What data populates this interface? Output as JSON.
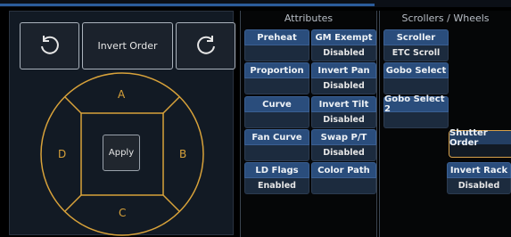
{
  "left": {
    "invert_order_label": "Invert Order",
    "apply_label": "Apply",
    "labels": {
      "a": "A",
      "b": "B",
      "c": "C",
      "d": "D"
    }
  },
  "attributes": {
    "title": "Attributes",
    "items": [
      {
        "label": "Preheat",
        "value": ""
      },
      {
        "label": "GM Exempt",
        "value": "Disabled"
      },
      {
        "label": "Proportion",
        "value": ""
      },
      {
        "label": "Invert Pan",
        "value": "Disabled"
      },
      {
        "label": "Curve",
        "value": ""
      },
      {
        "label": "Invert Tilt",
        "value": "Disabled"
      },
      {
        "label": "Fan Curve",
        "value": ""
      },
      {
        "label": "Swap P/T",
        "value": "Disabled"
      },
      {
        "label": "LD Flags",
        "value": "Enabled"
      },
      {
        "label": "Color Path",
        "value": ""
      }
    ]
  },
  "scrollers": {
    "title": "Scrollers / Wheels",
    "items": [
      {
        "label": "Scroller",
        "value": "ETC Scroll"
      },
      {
        "label": "Gobo Select",
        "value": ""
      },
      {
        "label": "Gobo Select 2",
        "value": ""
      }
    ]
  },
  "right": {
    "shutter_order_label": "Shutter Order",
    "invert_rack_label": "Invert Rack",
    "invert_rack_value": "Disabled"
  },
  "colors": {
    "accent": "#d8a23a",
    "button_top": "#2a4d7c",
    "button_bottom": "#1c2b3e"
  }
}
